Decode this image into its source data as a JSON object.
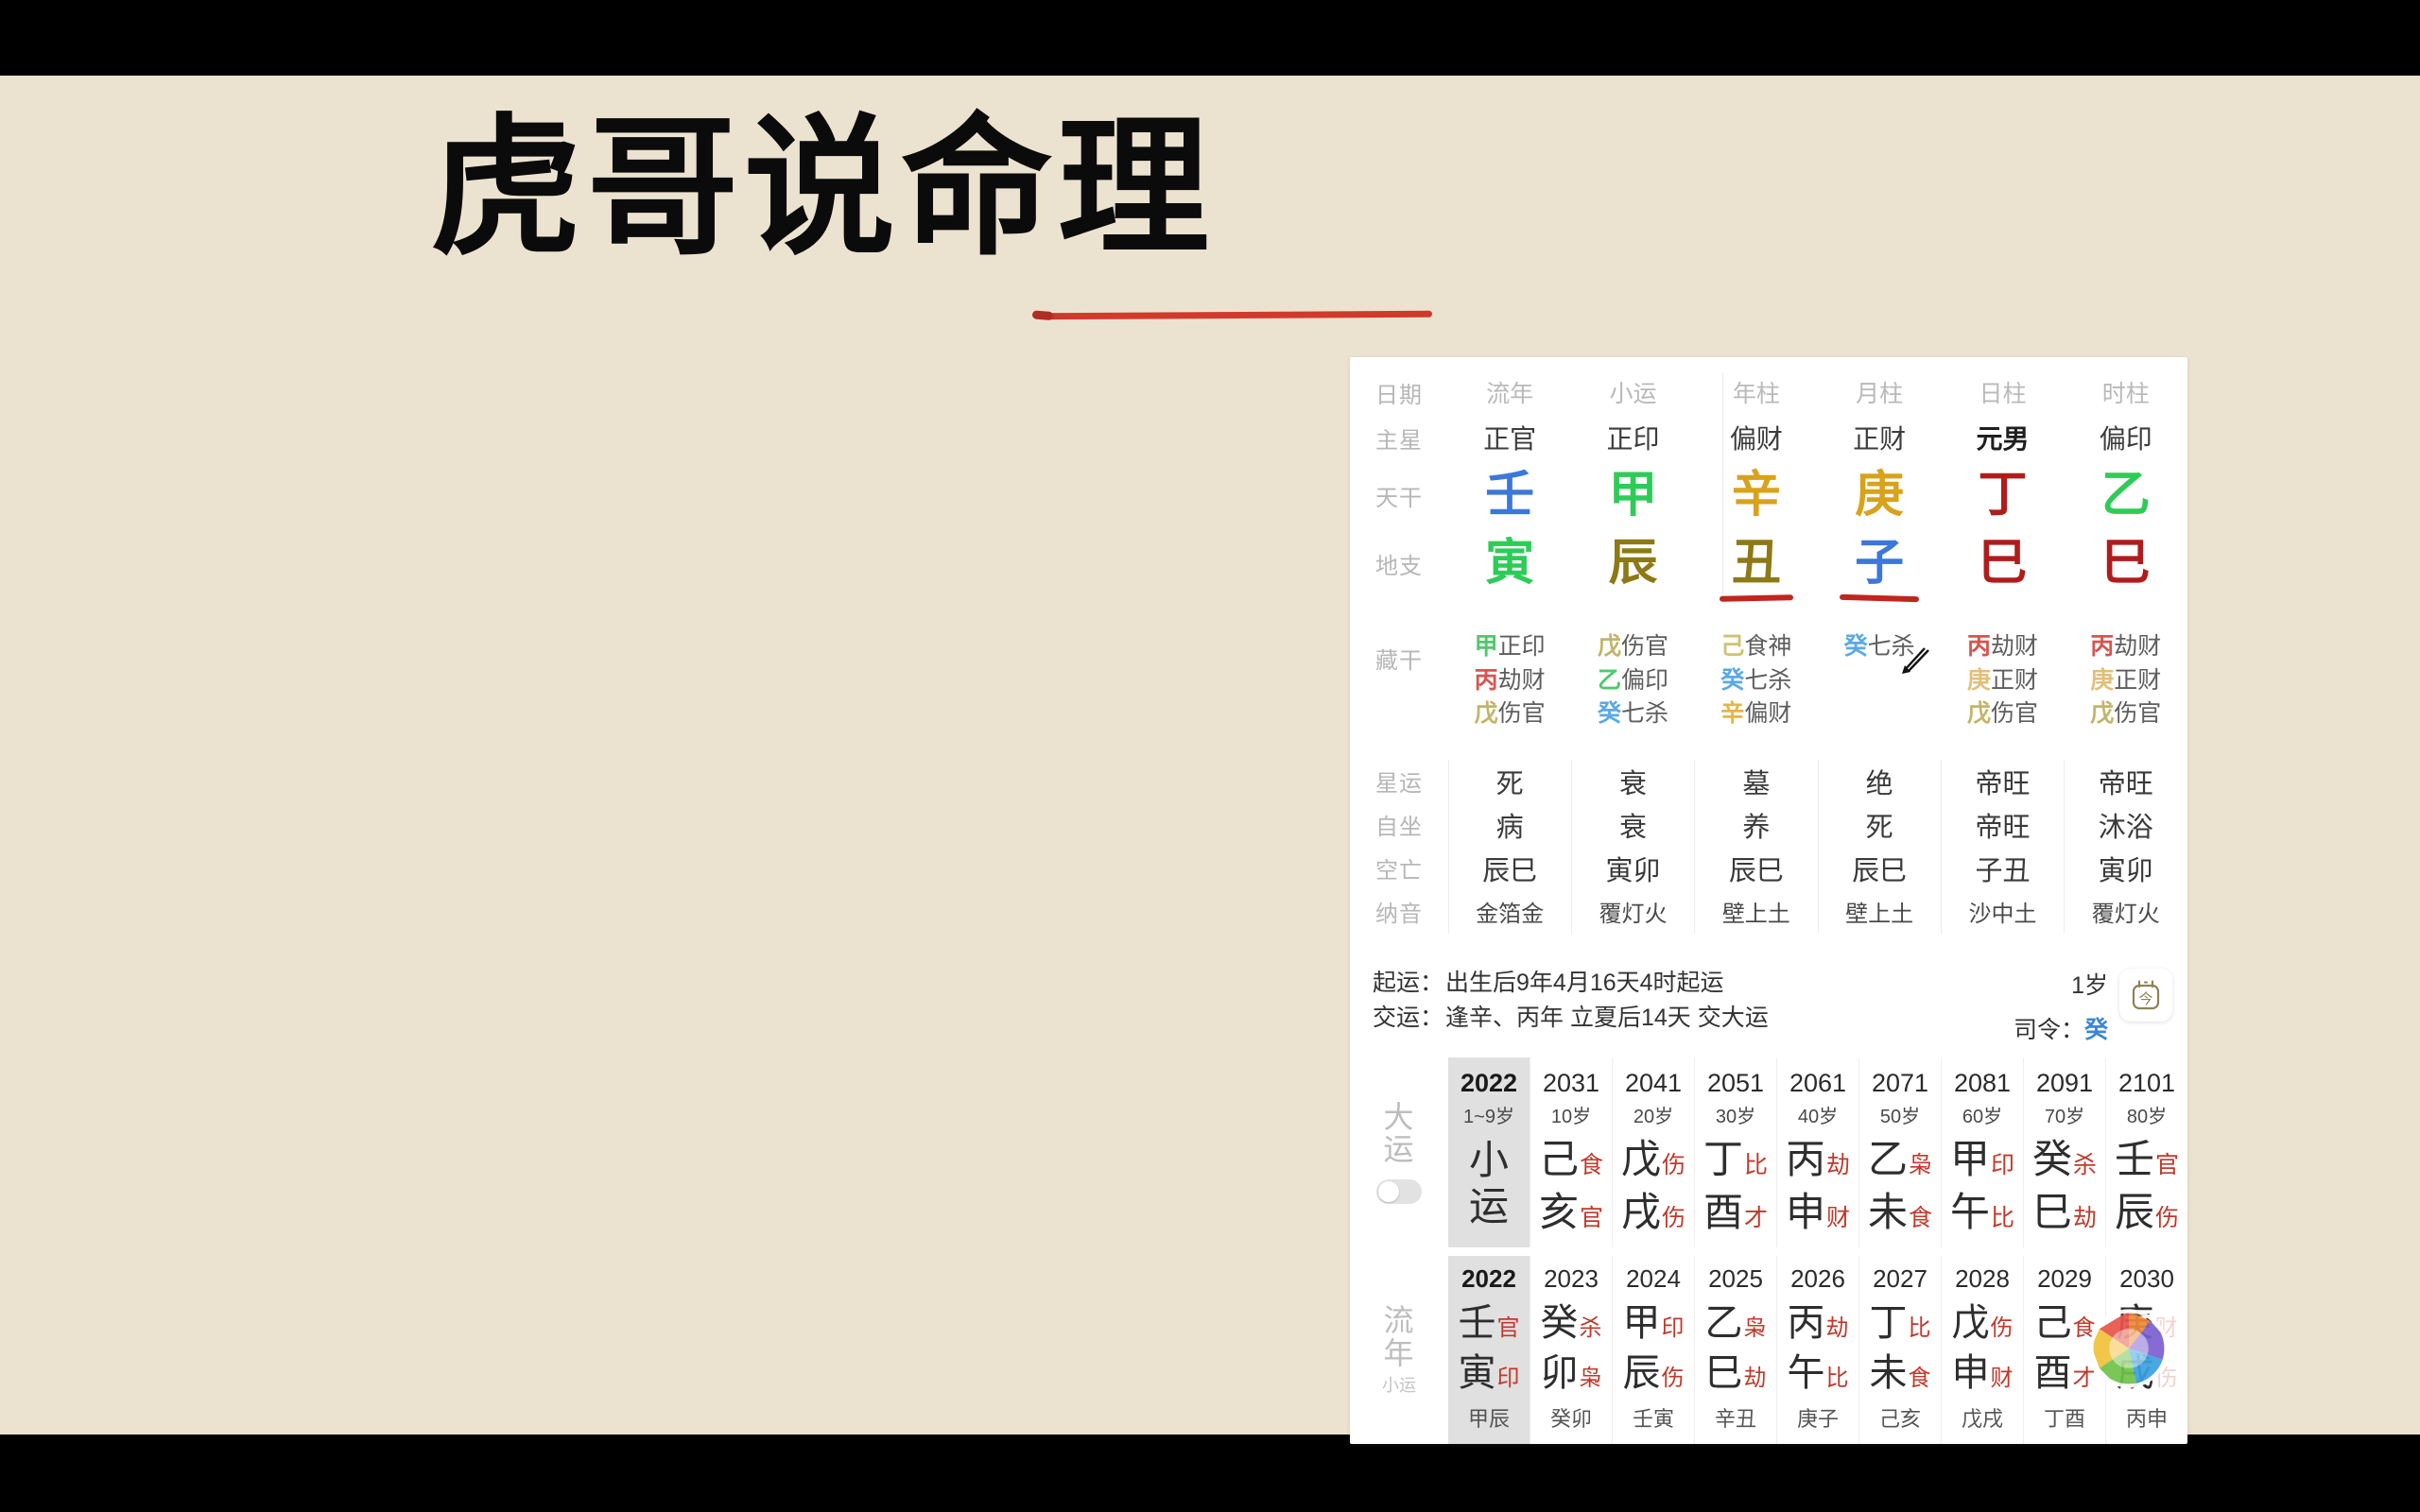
{
  "title": {
    "text": "虎哥说命理"
  },
  "head_table": {
    "columns": [
      "日期",
      "流年",
      "小运",
      "年柱",
      "月柱",
      "日柱",
      "时柱"
    ],
    "rows": [
      {
        "label": "主星",
        "values": [
          "正官",
          "正印",
          "偏财",
          "正财",
          "元男",
          "偏印"
        ],
        "bold_index": 4
      },
      {
        "label": "天干",
        "values": [
          "壬",
          "甲",
          "辛",
          "庚",
          "丁",
          "乙"
        ],
        "colors": [
          "#3c78d8",
          "#2ecc57",
          "#d9a21b",
          "#d9a21b",
          "#b01c1c",
          "#2ecc57"
        ]
      },
      {
        "label": "地支",
        "values": [
          "寅",
          "辰",
          "丑",
          "子",
          "巳",
          "巳"
        ],
        "colors": [
          "#2ecc57",
          "#8d7a16",
          "#8d7a16",
          "#3c78d8",
          "#b01c1c",
          "#b01c1c"
        ],
        "underlined": [
          false,
          false,
          true,
          true,
          false,
          false
        ]
      }
    ]
  },
  "hidden_stems": {
    "label": "藏干",
    "columns": [
      [
        {
          "stem": "甲",
          "god": "正印",
          "color": "#4fc96b"
        },
        {
          "stem": "丙",
          "god": "劫财",
          "color": "#d9534f"
        },
        {
          "stem": "戊",
          "god": "伤官",
          "color": "#c2b56a"
        }
      ],
      [
        {
          "stem": "戊",
          "god": "伤官",
          "color": "#c2b56a"
        },
        {
          "stem": "乙",
          "god": "偏印",
          "color": "#4fc96b"
        },
        {
          "stem": "癸",
          "god": "七杀",
          "color": "#5aa9e6"
        }
      ],
      [
        {
          "stem": "己",
          "god": "食神",
          "color": "#cfc26e"
        },
        {
          "stem": "癸",
          "god": "七杀",
          "color": "#5aa9e6"
        },
        {
          "stem": "辛",
          "god": "偏财",
          "color": "#e3b64a"
        }
      ],
      [
        {
          "stem": "癸",
          "god": "七杀",
          "color": "#5aa9e6"
        }
      ],
      [
        {
          "stem": "丙",
          "god": "劫财",
          "color": "#d9534f"
        },
        {
          "stem": "庚",
          "god": "正财",
          "color": "#e0c07a"
        },
        {
          "stem": "戊",
          "god": "伤官",
          "color": "#c2b56a"
        }
      ],
      [
        {
          "stem": "丙",
          "god": "劫财",
          "color": "#d9534f"
        },
        {
          "stem": "庚",
          "god": "正财",
          "color": "#e0c07a"
        },
        {
          "stem": "戊",
          "god": "伤官",
          "color": "#c2b56a"
        }
      ]
    ]
  },
  "stats": {
    "rows": [
      {
        "label": "星运",
        "values": [
          "死",
          "衰",
          "墓",
          "绝",
          "帝旺",
          "帝旺"
        ]
      },
      {
        "label": "自坐",
        "values": [
          "病",
          "衰",
          "养",
          "死",
          "帝旺",
          "沐浴"
        ]
      },
      {
        "label": "空亡",
        "values": [
          "辰巳",
          "寅卯",
          "辰巳",
          "辰巳",
          "子丑",
          "寅卯"
        ]
      },
      {
        "label": "纳音",
        "values": [
          "金箔金",
          "覆灯火",
          "壁上土",
          "壁上土",
          "沙中土",
          "覆灯火"
        ]
      }
    ]
  },
  "qiyun": {
    "line1_key": "起运：",
    "line1_value": "出生后9年4月16天4时起运",
    "line2_key": "交运：",
    "line2_value": "逢辛、丙年 立夏后14天 交大运",
    "age": "1岁",
    "siling_key": "司令：",
    "siling_value": "癸",
    "today_icon": "calendar-today-icon",
    "today_glyph": "今"
  },
  "dayun": {
    "label": "大运",
    "toggle": "off",
    "columns": [
      {
        "year": "2022",
        "age": "1~9岁",
        "selected": true,
        "special": "小\n运"
      },
      {
        "year": "2031",
        "age": "10岁",
        "top_big": "己",
        "top_small": "食",
        "bot_big": "亥",
        "bot_small": "官"
      },
      {
        "year": "2041",
        "age": "20岁",
        "top_big": "戊",
        "top_small": "伤",
        "bot_big": "戌",
        "bot_small": "伤"
      },
      {
        "year": "2051",
        "age": "30岁",
        "top_big": "丁",
        "top_small": "比",
        "bot_big": "酉",
        "bot_small": "才"
      },
      {
        "year": "2061",
        "age": "40岁",
        "top_big": "丙",
        "top_small": "劫",
        "bot_big": "申",
        "bot_small": "财"
      },
      {
        "year": "2071",
        "age": "50岁",
        "top_big": "乙",
        "top_small": "枭",
        "bot_big": "未",
        "bot_small": "食"
      },
      {
        "year": "2081",
        "age": "60岁",
        "top_big": "甲",
        "top_small": "印",
        "bot_big": "午",
        "bot_small": "比"
      },
      {
        "year": "2091",
        "age": "70岁",
        "top_big": "癸",
        "top_small": "杀",
        "bot_big": "巳",
        "bot_small": "劫"
      },
      {
        "year": "2101",
        "age": "80岁",
        "top_big": "壬",
        "top_small": "官",
        "bot_big": "辰",
        "bot_small": "伤"
      }
    ]
  },
  "liunian": {
    "label": "流年",
    "sub_label": "小运",
    "watermark": "shutter-icon",
    "columns": [
      {
        "year": "2022",
        "selected": true,
        "top_big": "壬",
        "top_small": "官",
        "bot_big": "寅",
        "bot_small": "印",
        "xiaoyun": "甲辰"
      },
      {
        "year": "2023",
        "top_big": "癸",
        "top_small": "杀",
        "bot_big": "卯",
        "bot_small": "枭",
        "xiaoyun": "癸卯"
      },
      {
        "year": "2024",
        "top_big": "甲",
        "top_small": "印",
        "bot_big": "辰",
        "bot_small": "伤",
        "xiaoyun": "壬寅"
      },
      {
        "year": "2025",
        "top_big": "乙",
        "top_small": "枭",
        "bot_big": "巳",
        "bot_small": "劫",
        "xiaoyun": "辛丑"
      },
      {
        "year": "2026",
        "top_big": "丙",
        "top_small": "劫",
        "bot_big": "午",
        "bot_small": "比",
        "xiaoyun": "庚子"
      },
      {
        "year": "2027",
        "top_big": "丁",
        "top_small": "比",
        "bot_big": "未",
        "bot_small": "食",
        "xiaoyun": "己亥"
      },
      {
        "year": "2028",
        "top_big": "戊",
        "top_small": "伤",
        "bot_big": "申",
        "bot_small": "财",
        "xiaoyun": "戊戌"
      },
      {
        "year": "2029",
        "top_big": "己",
        "top_small": "食",
        "bot_big": "酉",
        "bot_small": "才",
        "xiaoyun": "丁酉"
      },
      {
        "year": "2030",
        "top_big": "庚",
        "top_small": "财",
        "bot_big": "戌",
        "bot_small": "伤",
        "xiaoyun": "丙申"
      }
    ]
  },
  "colors": {
    "background": "#EBE3CF",
    "card": "#FFFFFF",
    "accent_red": "#c0392b",
    "muted_label": "#b9b9b9",
    "letterbox": "#000000"
  }
}
